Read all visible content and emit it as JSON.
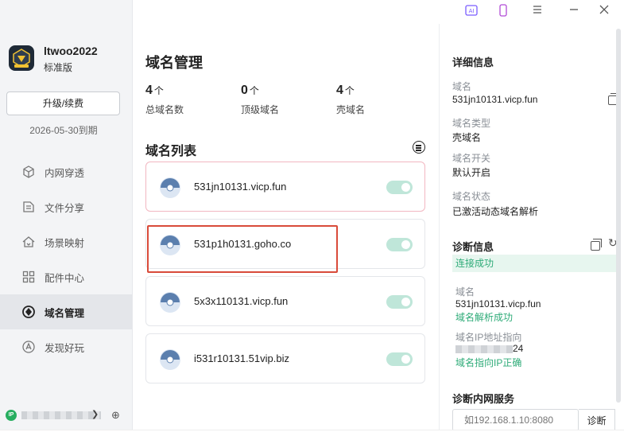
{
  "user": {
    "name": "ltwoo2022",
    "plan": "标准版",
    "upgrade_label": "升级/续费",
    "expire_date": "2026-05-30到期"
  },
  "sidebar": {
    "items": [
      {
        "label": "内网穿透",
        "icon": "cube-icon",
        "active": false
      },
      {
        "label": "文件分享",
        "icon": "file-share-icon",
        "active": false
      },
      {
        "label": "场景映射",
        "icon": "home-map-icon",
        "active": false
      },
      {
        "label": "配件中心",
        "icon": "grid-icon",
        "active": false
      },
      {
        "label": "域名管理",
        "icon": "domain-icon",
        "active": true
      },
      {
        "label": "发现好玩",
        "icon": "discover-icon",
        "active": false
      }
    ],
    "ip_badge": "IP"
  },
  "topbar": {
    "icons": [
      "ai-icon",
      "phone-icon",
      "menu-icon",
      "minimize-icon",
      "close-icon"
    ],
    "ai_label": "AI"
  },
  "main": {
    "title": "域名管理",
    "stats": [
      {
        "value": "4",
        "unit": "个",
        "label": "总域名数"
      },
      {
        "value": "0",
        "unit": "个",
        "label": "顶级域名"
      },
      {
        "value": "4",
        "unit": "个",
        "label": "壳域名"
      }
    ],
    "list_title": "域名列表",
    "domains": [
      {
        "name": "531jn10131.vicp.fun",
        "enabled": true
      },
      {
        "name": "531p1h0131.goho.co",
        "enabled": true
      },
      {
        "name": "5x3x110131.vicp.fun",
        "enabled": true
      },
      {
        "name": "i531r10131.51vip.biz",
        "enabled": true
      }
    ]
  },
  "detail": {
    "title": "详细信息",
    "domain_label": "域名",
    "domain_value": "531jn10131.vicp.fun",
    "type_label": "域名类型",
    "type_value": "壳域名",
    "switch_label": "域名开关",
    "switch_value": "默认开启",
    "status_label": "域名状态",
    "status_value": "已激活动态域名解析"
  },
  "diagnosis": {
    "title": "诊断信息",
    "connect_status": "连接成功",
    "domain_label": "域名",
    "domain_value": "531jn10131.vicp.fun",
    "resolve_status": "域名解析成功",
    "ip_label": "域名IP地址指向",
    "ip_suffix": "24",
    "ip_status": "域名指向IP正确"
  },
  "intranet_diag": {
    "title": "诊断内网服务",
    "placeholder": "如192.168.1.10:8080",
    "button_label": "诊断"
  },
  "colors": {
    "accent_green": "#2eab78",
    "toggle_bg": "#bfe6d9",
    "selected_border": "#f2b7c1",
    "highlight_red": "#d94b3a"
  }
}
